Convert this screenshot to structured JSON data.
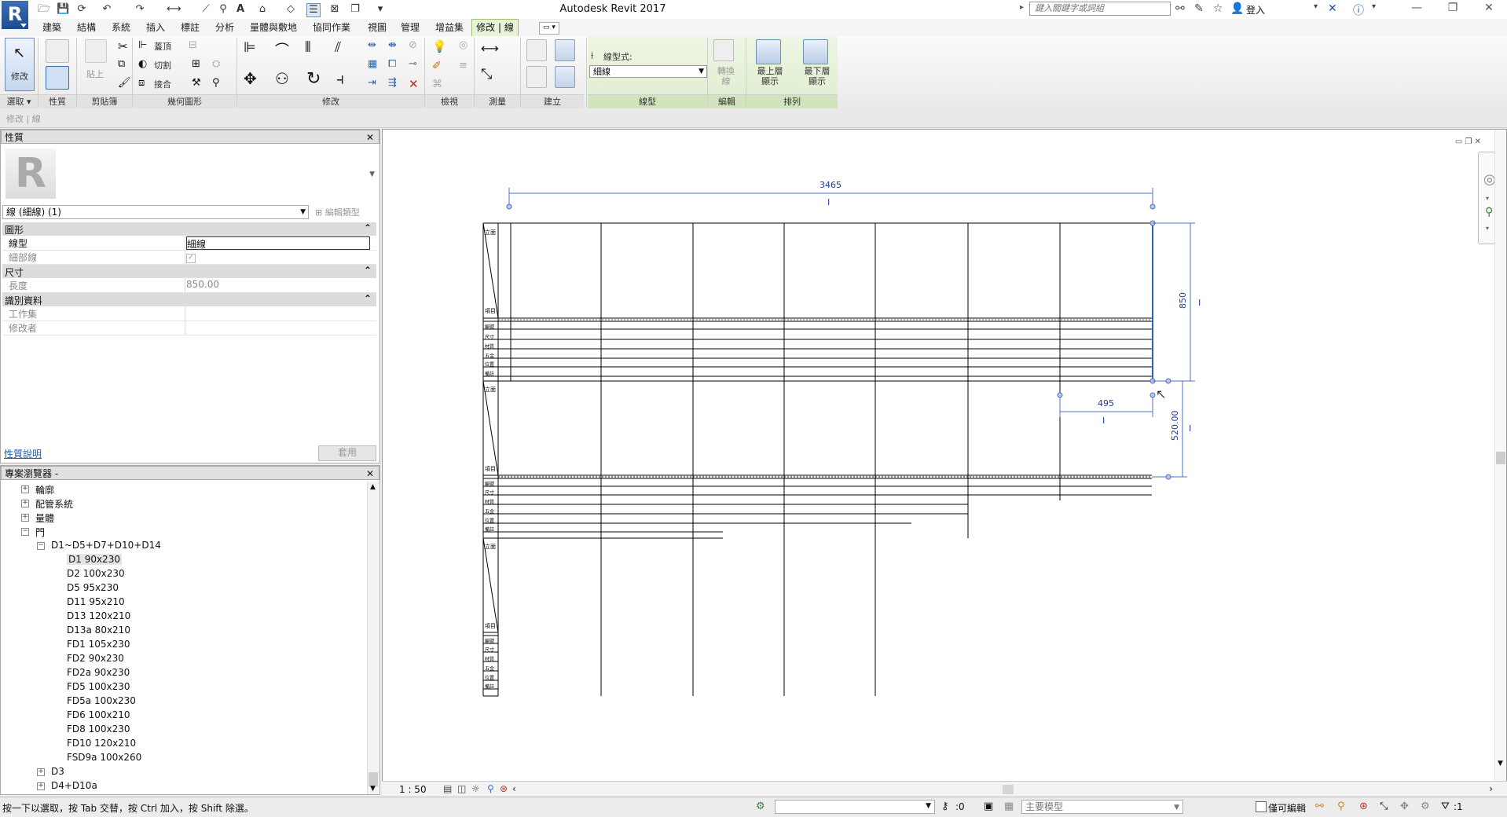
{
  "app": {
    "title": "Autodesk Revit 2017",
    "logo": "R"
  },
  "search": {
    "placeholder": "鍵入關鍵字或詞組"
  },
  "user": {
    "sign_in": "登入"
  },
  "tabs": [
    "建築",
    "結構",
    "系統",
    "插入",
    "標註",
    "分析",
    "量體與敷地",
    "協同作業",
    "視圖",
    "管理",
    "增益集",
    "修改 | 線"
  ],
  "ribbon": {
    "modify_label": "修改",
    "panels": [
      "選取",
      "性質",
      "剪貼簿",
      "幾何圖形",
      "修改",
      "檢視",
      "測量",
      "建立",
      "線型",
      "編輯",
      "排列"
    ],
    "clipboard_paste": "貼上",
    "geom": [
      "蓋頂",
      "切割",
      "接合"
    ],
    "linestyle_label": "線型式:",
    "linestyle_value": "細線",
    "edit_btn": "轉換\n線",
    "arrange_front": "最上層\n顯示",
    "arrange_back": "最下層\n顯示"
  },
  "optbar": {
    "text": "修改 | 線"
  },
  "properties": {
    "title": "性質",
    "type_selector": "線 (細線) (1)",
    "edit_type": "編輯類型",
    "categories": [
      {
        "name": "圖形",
        "rows": [
          {
            "k": "線型",
            "v": "細線"
          },
          {
            "k": "細部線",
            "v": ""
          }
        ]
      },
      {
        "name": "尺寸",
        "rows": [
          {
            "k": "長度",
            "v": "850.00"
          }
        ]
      },
      {
        "name": "識別資料",
        "rows": [
          {
            "k": "工作集",
            "v": ""
          },
          {
            "k": "修改者",
            "v": ""
          }
        ]
      }
    ],
    "help_link": "性質說明",
    "apply": "套用"
  },
  "browser": {
    "title": "專案瀏覽器 -",
    "items": [
      {
        "label": "輪廓",
        "level": 1,
        "exp": "+"
      },
      {
        "label": "配管系統",
        "level": 1,
        "exp": "+"
      },
      {
        "label": "量體",
        "level": 1,
        "exp": "+"
      },
      {
        "label": "門",
        "level": 1,
        "exp": "-"
      },
      {
        "label": "D1~D5+D7+D10+D14",
        "level": 2,
        "exp": "-"
      },
      {
        "label": "D1 90x230",
        "level": 3,
        "selected": true
      },
      {
        "label": "D2 100x230",
        "level": 3
      },
      {
        "label": "D5 95x230",
        "level": 3
      },
      {
        "label": "D11 95x210",
        "level": 3
      },
      {
        "label": "D13 120x210",
        "level": 3
      },
      {
        "label": "D13a 80x210",
        "level": 3
      },
      {
        "label": "FD1 105x230",
        "level": 3
      },
      {
        "label": "FD2 90x230",
        "level": 3
      },
      {
        "label": "FD2a 90x230",
        "level": 3
      },
      {
        "label": "FD5 100x230",
        "level": 3
      },
      {
        "label": "FD5a 100x230",
        "level": 3
      },
      {
        "label": "FD6 100x210",
        "level": 3
      },
      {
        "label": "FD8 100x230",
        "level": 3
      },
      {
        "label": "FD10 120x210",
        "level": 3
      },
      {
        "label": "FSD9a 100x260",
        "level": 3
      },
      {
        "label": "D3",
        "level": 2,
        "exp": "+"
      },
      {
        "label": "D4+D10a",
        "level": 2,
        "exp": "+"
      }
    ]
  },
  "drawing": {
    "dims": {
      "top": "3465",
      "right": "850",
      "small": "495",
      "vertical2": "520.00"
    },
    "row_labels_top": [
      "立面",
      "項目",
      "編號",
      "尺寸",
      "材質",
      "五金",
      "位置",
      "備註"
    ]
  },
  "viewbar": {
    "scale": "1 : 50"
  },
  "status": {
    "hint": "按一下以選取，按 Tab 交替，按 Ctrl 加入，按 Shift 除選。",
    "counter": ":0",
    "model": "主要模型",
    "editable": "僅可編輯",
    "filter": ":1"
  }
}
